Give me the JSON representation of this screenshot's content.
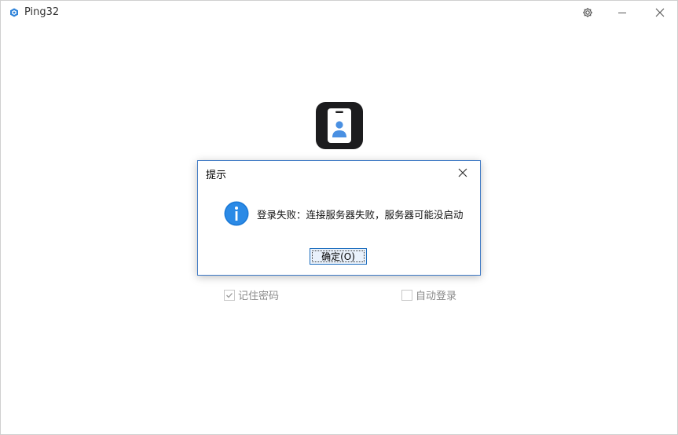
{
  "app": {
    "title": "Ping32",
    "icon": "cube-icon",
    "accent": "#2f83d9"
  },
  "titlebar": {
    "settings_icon": "gear-icon",
    "minimize_icon": "minimize-icon",
    "close_icon": "close-icon"
  },
  "logo": {
    "icon": "badge-user-icon",
    "bg_color": "#1c1c1e",
    "figure_color": "#4a90e2"
  },
  "options": {
    "remember_password": {
      "label": "记住密码",
      "checked": true
    },
    "auto_login": {
      "label": "自动登录",
      "checked": false
    }
  },
  "dialog": {
    "title": "提示",
    "message": "登录失败：连接服务器失败，服务器可能没启动",
    "ok_label": "确定(O)",
    "icon": "info-icon",
    "icon_color": "#1a78d6"
  }
}
